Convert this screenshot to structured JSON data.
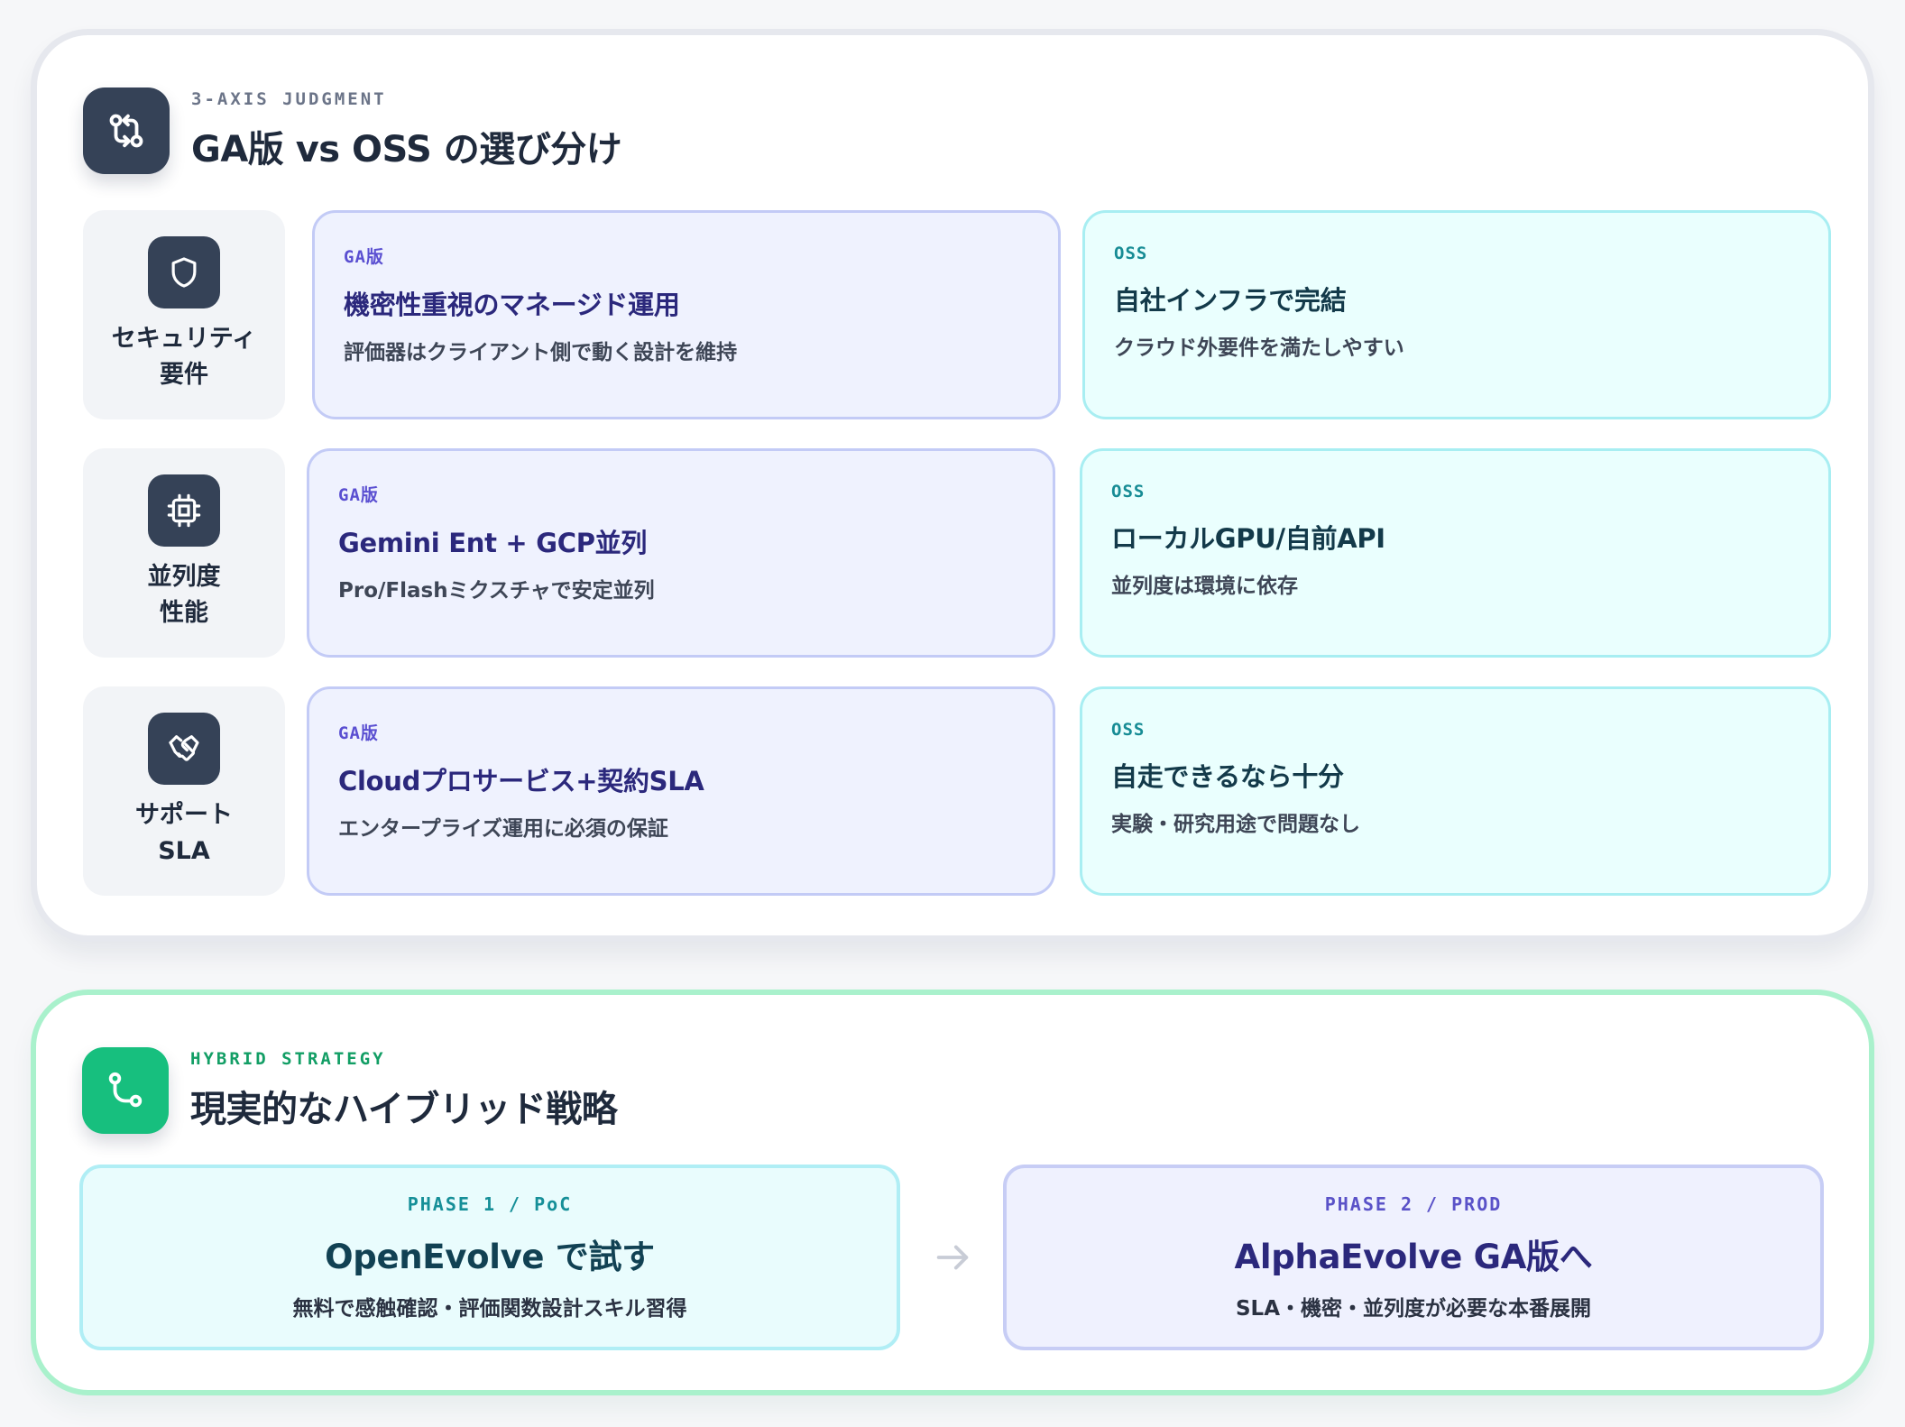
{
  "comparison": {
    "eyebrow": "3-AXIS JUDGMENT",
    "title": "GA版 vs OSS の選び分け",
    "icon": "git-compare-icon",
    "rows": [
      {
        "axis": "セキュリティ\n要件",
        "icon": "shield-icon",
        "ga": {
          "tag": "GA版",
          "title": "機密性重視のマネージド運用",
          "desc": "評価器はクライアント側で動く設計を維持"
        },
        "oss": {
          "tag": "OSS",
          "title": "自社インフラで完結",
          "desc": "クラウド外要件を満たしやすい"
        }
      },
      {
        "axis": "並列度\n性能",
        "icon": "cpu-chip-icon",
        "ga": {
          "tag": "GA版",
          "title": "Gemini Ent + GCP並列",
          "desc": "Pro/Flashミクスチャで安定並列"
        },
        "oss": {
          "tag": "OSS",
          "title": "ローカルGPU/自前API",
          "desc": "並列度は環境に依存"
        }
      },
      {
        "axis": "サポート\nSLA",
        "icon": "handshake-icon",
        "ga": {
          "tag": "GA版",
          "title": "Cloudプロサービス+契約SLA",
          "desc": "エンタープライズ運用に必須の保証"
        },
        "oss": {
          "tag": "OSS",
          "title": "自走できるなら十分",
          "desc": "実験・研究用途で問題なし"
        }
      }
    ]
  },
  "strategy": {
    "eyebrow": "HYBRID STRATEGY",
    "title": "現実的なハイブリッド戦略",
    "icon": "git-branch-icon",
    "phase1": {
      "tag": "PHASE 1 / PoC",
      "title": "OpenEvolve で試す",
      "desc": "無料で感触確認・評価関数設計スキル習得"
    },
    "phase2": {
      "tag": "PHASE 2 / PROD",
      "title": "AlphaEvolve GA版へ",
      "desc": "SLA・機密・並列度が必要な本番展開"
    },
    "arrow": "arrow-right-icon"
  },
  "colors": {
    "dark_icon": "#354257",
    "green_accent": "#17bf7e",
    "ga_accent": "#5a4fd1",
    "oss_accent": "#178c95"
  }
}
